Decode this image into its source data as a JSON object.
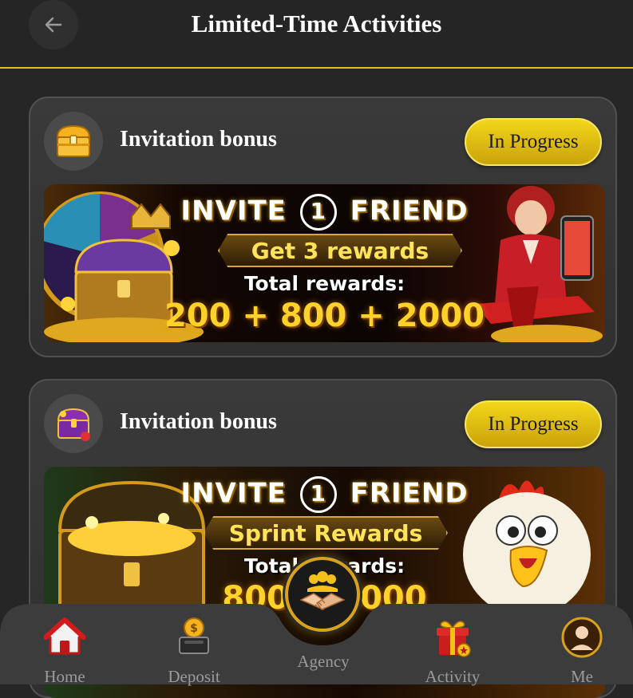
{
  "header": {
    "title": "Limited-Time Activities",
    "back_icon": "arrow-left-icon"
  },
  "activities": [
    {
      "title": "Invitation bonus",
      "status": "In Progress",
      "icon": "treasure-chest-icon",
      "banner": {
        "headline_left": "INVITE",
        "headline_number": "1",
        "headline_right": "FRIEND",
        "ribbon": "Get 3 rewards",
        "total_label": "Total rewards:",
        "total_values": "200 + 800 + 2000"
      }
    },
    {
      "title": "Invitation bonus",
      "status": "In Progress",
      "icon": "gift-chest-icon",
      "banner": {
        "headline_left": "INVITE",
        "headline_number": "1",
        "headline_right": "FRIEND",
        "ribbon": "Sprint Rewards",
        "total_label": "Total rewards:",
        "total_values": "800 + 3000"
      }
    }
  ],
  "nav": {
    "items": [
      {
        "label": "Home",
        "icon": "home-icon",
        "active": false
      },
      {
        "label": "Deposit",
        "icon": "deposit-icon",
        "active": false
      },
      {
        "label": "Agency",
        "icon": "handshake-icon",
        "active": false
      },
      {
        "label": "Activity",
        "icon": "gift-icon",
        "active": true
      },
      {
        "label": "Me",
        "icon": "user-icon",
        "active": false
      }
    ]
  },
  "colors": {
    "accent": "#f2cf16",
    "background": "#262626",
    "card": "#353535"
  }
}
